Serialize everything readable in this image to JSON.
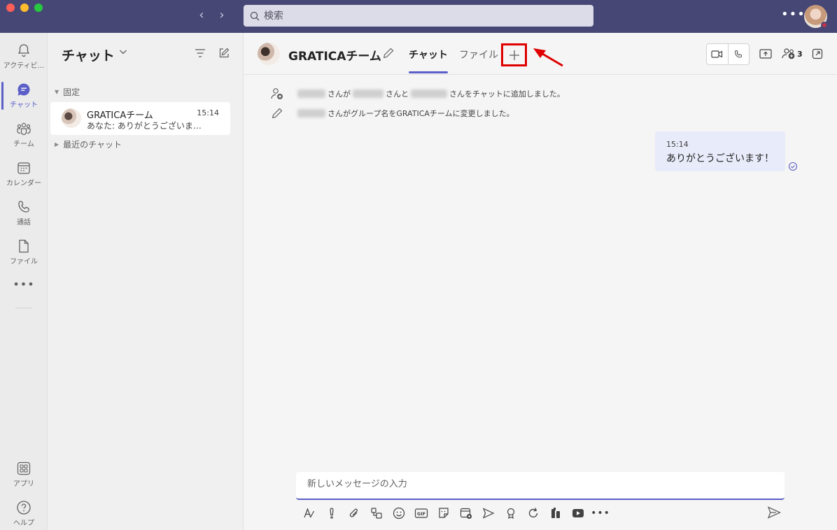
{
  "app": {
    "search_placeholder": "検索",
    "more_label": "•••"
  },
  "rail": {
    "items": [
      {
        "label": "アクティビ...",
        "icon": "bell-icon"
      },
      {
        "label": "チャット",
        "icon": "chat-icon"
      },
      {
        "label": "チーム",
        "icon": "teams-icon"
      },
      {
        "label": "カレンダー",
        "icon": "calendar-icon"
      },
      {
        "label": "通話",
        "icon": "phone-icon"
      },
      {
        "label": "ファイル",
        "icon": "file-icon"
      },
      {
        "label": "アプリ",
        "icon": "apps-icon"
      },
      {
        "label": "ヘルプ",
        "icon": "help-icon"
      }
    ],
    "more_label": "•••"
  },
  "chatlist": {
    "title": "チャット",
    "pinned_label": "固定",
    "recent_label": "最近のチャット",
    "items": [
      {
        "name": "GRATICAチーム",
        "time": "15:14",
        "preview": "あなた: ありがとうございます！"
      }
    ]
  },
  "conversation": {
    "title": "GRATICAチーム",
    "tabs": [
      "チャット",
      "ファイル"
    ],
    "add_tab_symbol": "+",
    "participant_count": "3",
    "system_messages": [
      {
        "parts": [
          "さんが",
          "さんと",
          "さんをチャットに追加しました。"
        ]
      },
      {
        "parts": [
          "さんがグループ名をGRATICAチームに変更しました。"
        ]
      }
    ],
    "messages": [
      {
        "time": "15:14",
        "text": "ありがとうございます！"
      }
    ],
    "compose_placeholder": "新しいメッセージの入力",
    "toolbar_more": "•••",
    "gif_label": "GIF"
  },
  "colors": {
    "titlebar": "#464775",
    "accent": "#5b5fc7",
    "highlight": "#e00000"
  }
}
